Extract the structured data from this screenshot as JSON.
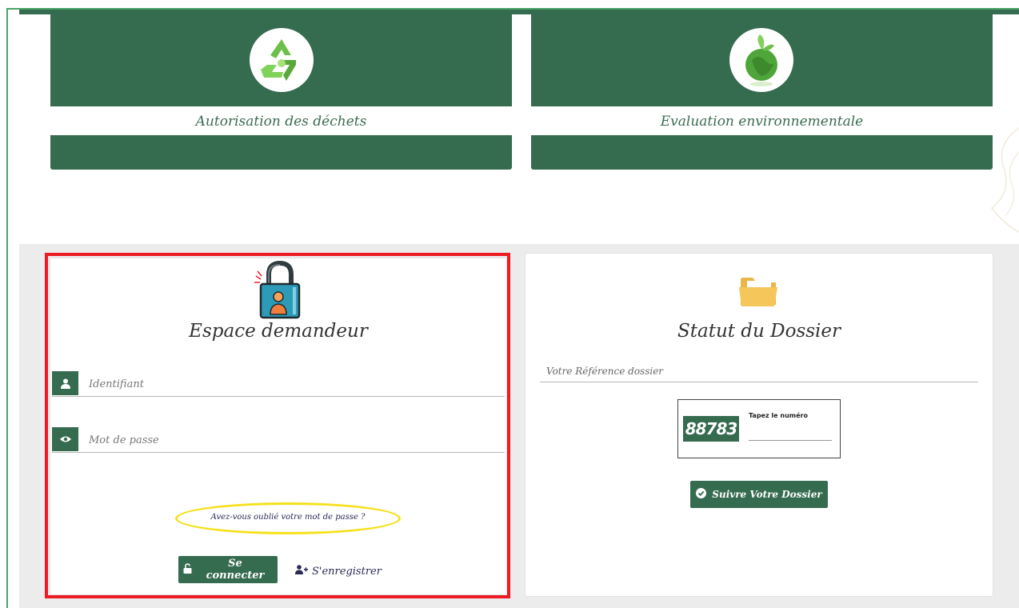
{
  "services": [
    {
      "title": "Autorisation des déchets",
      "icon": "recycle-icon"
    },
    {
      "title": "Evaluation environnementale",
      "icon": "globe-leaf-icon"
    }
  ],
  "login": {
    "heading": "Espace demandeur",
    "icon": "padlock-user-icon",
    "username_placeholder": "Identifiant",
    "password_placeholder": "Mot de passe",
    "forgot_label": "Avez-vous oublié votre mot de passe ?",
    "login_label": "Se connecter",
    "register_label": "S'enregistrer"
  },
  "status": {
    "heading": "Statut du Dossier",
    "icon": "folder-icon",
    "reference_placeholder": "Votre Référence dossier",
    "captcha_code": "88783",
    "captcha_label": "Tapez le numéro",
    "track_label": "Suivre Votre Dossier"
  },
  "colors": {
    "primary_green": "#356b4f",
    "highlight_red": "#ed1c24",
    "highlight_yellow": "#f5e11d",
    "folder_yellow": "#f5c65a"
  }
}
